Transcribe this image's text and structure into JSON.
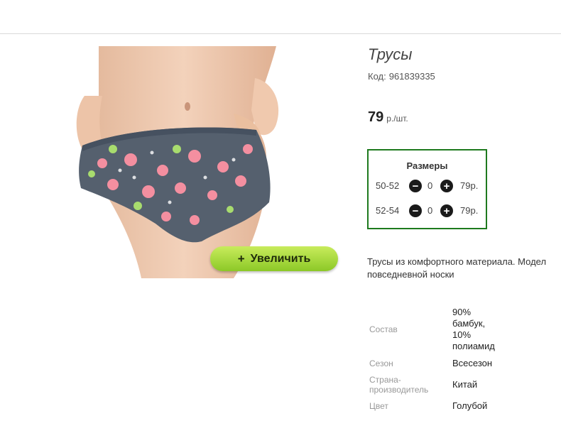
{
  "product": {
    "title": "Трусы",
    "code_label": "Код:",
    "code": "961839335",
    "price_value": "79",
    "price_unit": "р./шт.",
    "zoom_label": "Увеличить",
    "zoom_icon": "plus-icon"
  },
  "sizes": {
    "title": "Размеры",
    "rows": [
      {
        "size": "50-52",
        "qty": "0",
        "price": "79р."
      },
      {
        "size": "52-54",
        "qty": "0",
        "price": "79р."
      }
    ]
  },
  "description": {
    "line1": "Трусы из комфортного материала. Модел",
    "line2": "повседневной носки"
  },
  "specs": {
    "composition_label": "Состав",
    "composition_lines": [
      "90%",
      "бамбук,",
      "10%",
      "полиамид"
    ],
    "season_label": "Сезон",
    "season": "Всесезон",
    "country_label_1": "Страна-",
    "country_label_2": "производитель",
    "country": "Китай",
    "color_label": "Цвет",
    "color": "Голубой"
  },
  "colors": {
    "fabric": "#55606e",
    "sizes_border": "#1e7a1e",
    "zoom_button": "#a6d93c"
  }
}
